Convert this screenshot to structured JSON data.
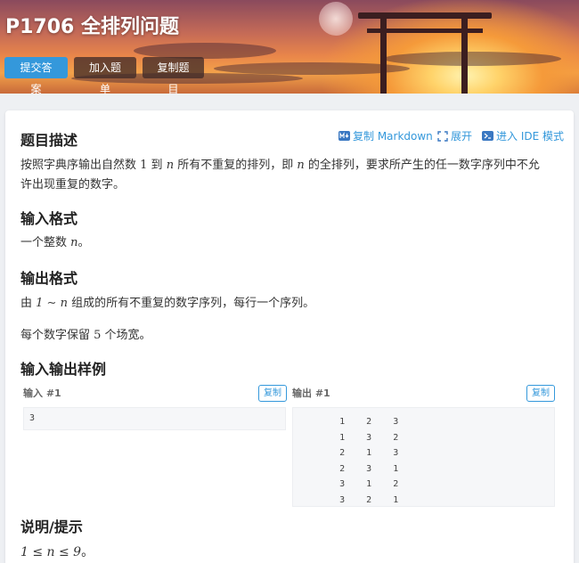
{
  "header": {
    "title": "P1706 全排列问题",
    "buttons": {
      "submit": "提交答案",
      "add_list": "加入题单",
      "copy_problem": "复制题目"
    }
  },
  "toolbar": {
    "copy_markdown": "复制 Markdown",
    "expand": "展开",
    "ide_mode": "进入 IDE 模式"
  },
  "sections": {
    "description_title": "题目描述",
    "description_line1_a": "按照字典序输出自然数 ",
    "description_num": "1",
    "description_line1_b": " 到 ",
    "description_var": "n",
    "description_line1_c": " 所有不重复的排列，即 ",
    "description_line1_d": " 的全排列，要求所产生的任一数字序列中不允",
    "description_line2": "许出现重复的数字。",
    "input_title": "输入格式",
    "input_a": "一个整数 ",
    "input_var": "n",
    "input_b": "。",
    "output_title": "输出格式",
    "output_a": "由 ",
    "output_math": "1 ∼ n",
    "output_b": " 组成的所有不重复的数字序列，每行一个序列。",
    "output2_a": "每个数字保留 ",
    "output2_num": "5",
    "output2_b": " 个场宽。",
    "samples_title": "输入输出样例",
    "hint_title": "说明/提示",
    "hint_math": "1 ≤ n ≤ 9",
    "hint_end": "。"
  },
  "samples": {
    "input_label": "输入 #1",
    "output_label": "输出 #1",
    "copy_label": "复制",
    "input_value": "3",
    "output_lines": [
      "    1    2    3",
      "    1    3    2",
      "    2    1    3",
      "    2    3    1",
      "    3    1    2",
      "    3    2    1"
    ]
  }
}
